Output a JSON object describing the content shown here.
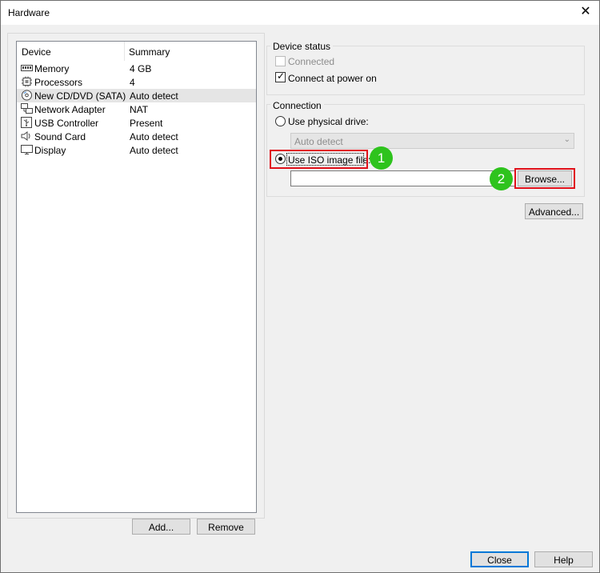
{
  "window": {
    "title": "Hardware",
    "close_glyph": "✕"
  },
  "device_list": {
    "headers": {
      "device": "Device",
      "summary": "Summary"
    },
    "rows": [
      {
        "name": "Memory",
        "summary": "4 GB",
        "icon": "memory-icon"
      },
      {
        "name": "Processors",
        "summary": "4",
        "icon": "processor-icon"
      },
      {
        "name": "New CD/DVD (SATA)",
        "summary": "Auto detect",
        "icon": "cd-dvd-icon",
        "selected": true
      },
      {
        "name": "Network Adapter",
        "summary": "NAT",
        "icon": "network-adapter-icon"
      },
      {
        "name": "USB Controller",
        "summary": "Present",
        "icon": "usb-icon"
      },
      {
        "name": "Sound Card",
        "summary": "Auto detect",
        "icon": "speaker-icon"
      },
      {
        "name": "Display",
        "summary": "Auto detect",
        "icon": "monitor-icon"
      }
    ]
  },
  "left_buttons": {
    "add": "Add...",
    "remove": "Remove"
  },
  "device_status": {
    "label": "Device status",
    "connected": {
      "label": "Connected",
      "checked": false,
      "disabled": true
    },
    "connect_at_power_on": {
      "label": "Connect at power on",
      "checked": true
    }
  },
  "connection": {
    "label": "Connection",
    "physical_drive": {
      "label": "Use physical drive:",
      "selected": false
    },
    "drive_select": {
      "value": "Auto detect",
      "disabled": true
    },
    "iso_image": {
      "label": "Use ISO image file:",
      "selected": true
    },
    "iso_path": {
      "value": ""
    },
    "browse": "Browse..."
  },
  "advanced": "Advanced...",
  "annotations": {
    "step1": "1",
    "step2": "2",
    "highlight_color": "#e0101a",
    "badge_color": "#2ec31d"
  },
  "footer": {
    "close": "Close",
    "help": "Help"
  }
}
